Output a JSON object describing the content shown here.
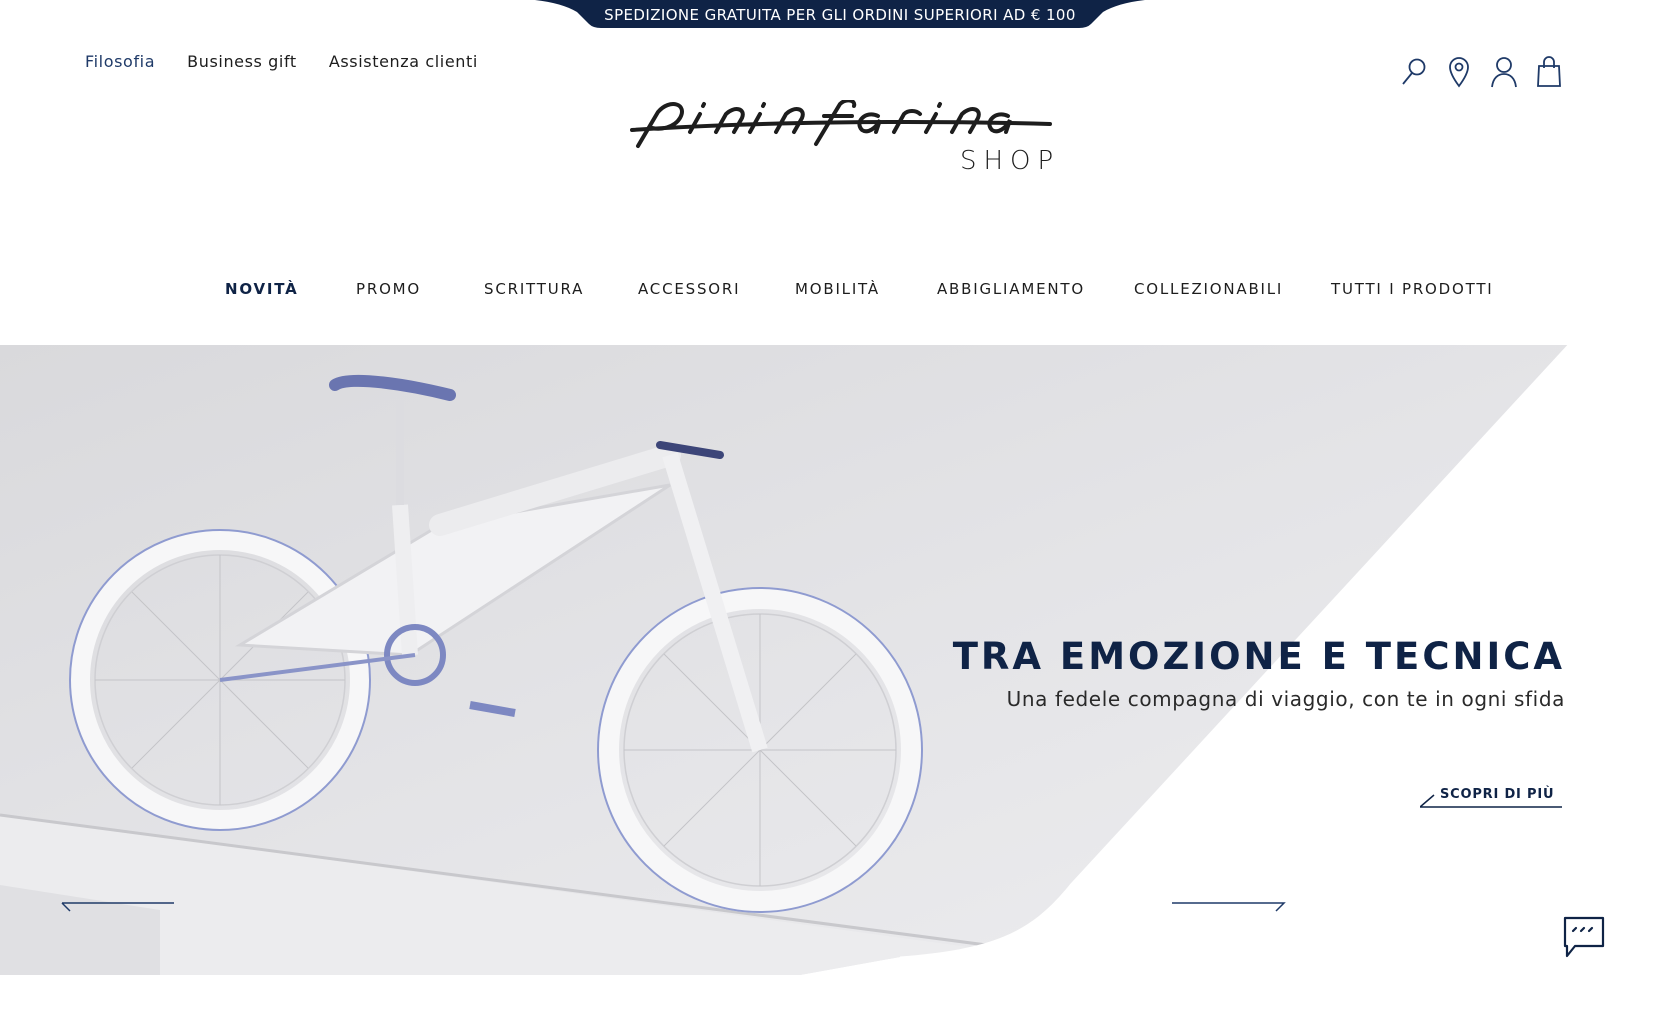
{
  "promo_bar": {
    "text": "SPEDIZIONE GRATUITA PER GLI ORDINI SUPERIORI AD € 100",
    "color": "#0f2346"
  },
  "util_nav": [
    {
      "label": "Filosofia"
    },
    {
      "label": "Business gift"
    },
    {
      "label": "Assistenza clienti"
    }
  ],
  "header_icons": [
    "search-icon",
    "store-locator-icon",
    "account-icon",
    "cart-icon"
  ],
  "logo": {
    "script_text": "pininfarina",
    "sub_text": "SHOP"
  },
  "main_nav": [
    {
      "label": "NOVITÀ"
    },
    {
      "label": "PROMO"
    },
    {
      "label": "SCRITTURA"
    },
    {
      "label": "ACCESSORI"
    },
    {
      "label": "MOBILITÀ"
    },
    {
      "label": "ABBIGLIAMENTO"
    },
    {
      "label": "COLLEZIONABILI"
    },
    {
      "label": "TUTTI I PRODOTTI"
    }
  ],
  "hero": {
    "title": "TRA EMOZIONE E TECNICA",
    "subtitle": "Una fedele compagna di viaggio, con te in ogni sfida",
    "cta_label": "SCOPRI DI PIÙ"
  },
  "colors": {
    "accent": "#0f2346",
    "link_active": "#1f3a68",
    "hero_bg": "#dcdcdf"
  }
}
